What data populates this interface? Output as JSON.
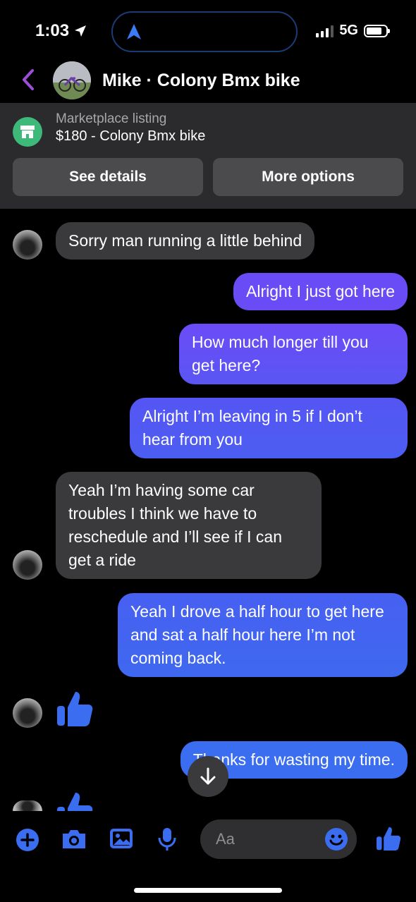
{
  "status": {
    "time": "1:03",
    "network": "5G"
  },
  "header": {
    "title": "Mike · Colony Bmx bike"
  },
  "listing": {
    "label": "Marketplace listing",
    "title": "$180 - Colony Bmx bike",
    "details_button": "See details",
    "options_button": "More options"
  },
  "messages": [
    {
      "sender": "them",
      "text": "Sorry man running a little behind"
    },
    {
      "sender": "me",
      "text": "Alright I just got here"
    },
    {
      "sender": "me",
      "text": "How much longer till you get here?"
    },
    {
      "sender": "me",
      "text": "Alright I’m leaving in 5 if I don’t hear from you"
    },
    {
      "sender": "them",
      "text": "Yeah I’m having some car troubles I think we have to reschedule and I’ll see if I can get a ride"
    },
    {
      "sender": "me",
      "text": "Yeah I drove a half hour to get here and sat a half hour here I’m not coming back."
    },
    {
      "sender": "them",
      "text": "👍"
    },
    {
      "sender": "me",
      "text": "Thanks for wasting my time."
    },
    {
      "sender": "them",
      "text": "👍"
    }
  ],
  "composer": {
    "placeholder": "Aa"
  },
  "colors": {
    "accent": "#3a6df0",
    "bubble_out_top": "#7b4cf5",
    "bubble_out_bottom": "#3a6df0",
    "bubble_in": "#3a3a3c",
    "marketplace": "#3dba7a",
    "back_arrow": "#9b4fd8"
  }
}
